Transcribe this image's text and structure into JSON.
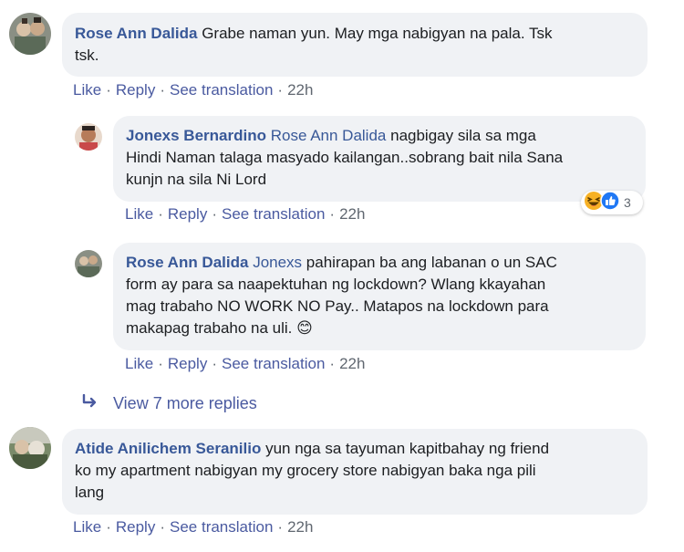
{
  "comments": [
    {
      "author": "Rose Ann Dalida",
      "mention": "",
      "text_line1": "Grabe naman yun. May mga nabigyan na pala. Tsk",
      "text_line2": "tsk.",
      "actions": {
        "like": "Like",
        "reply": "Reply",
        "translate": "See translation",
        "time": "22h"
      }
    },
    {
      "author": "Jonexs Bernardino",
      "mention": "Rose Ann Dalida",
      "text_line1": "nagbigay sila sa mga",
      "text_line2": "Hindi Naman talaga masyado kailangan..sobrang bait nila Sana",
      "text_line3": "kunjn na sila Ni Lord",
      "reactions": {
        "icons": [
          "haha-icon",
          "like-icon"
        ],
        "count": "3"
      },
      "actions": {
        "like": "Like",
        "reply": "Reply",
        "translate": "See translation",
        "time": "22h"
      }
    },
    {
      "author": "Rose Ann Dalida",
      "mention": "Jonexs",
      "text_line1": "pahirapan ba ang labanan o un SAC",
      "text_line2": "form ay para sa naapektuhan ng lockdown? Wlang kkayahan",
      "text_line3": "mag trabaho NO WORK NO Pay.. Matapos na lockdown para",
      "text_line4": "makapag trabaho na uli.",
      "emoji": "😊",
      "actions": {
        "like": "Like",
        "reply": "Reply",
        "translate": "See translation",
        "time": "22h"
      }
    },
    {
      "author": "Atide Anilichem Seranilio",
      "mention": "",
      "text_line1": "yun nga sa tayuman kapitbahay ng friend",
      "text_line2": "ko my apartment nabigyan my grocery store nabigyan baka nga pili",
      "text_line3": "lang",
      "actions": {
        "like": "Like",
        "reply": "Reply",
        "translate": "See translation",
        "time": "22h"
      }
    }
  ],
  "view_more": {
    "label": "View 7 more replies",
    "icon": "reply-arrow-icon"
  },
  "colors": {
    "link": "#385898",
    "bubble": "#f0f2f5",
    "meta": "#606770"
  }
}
